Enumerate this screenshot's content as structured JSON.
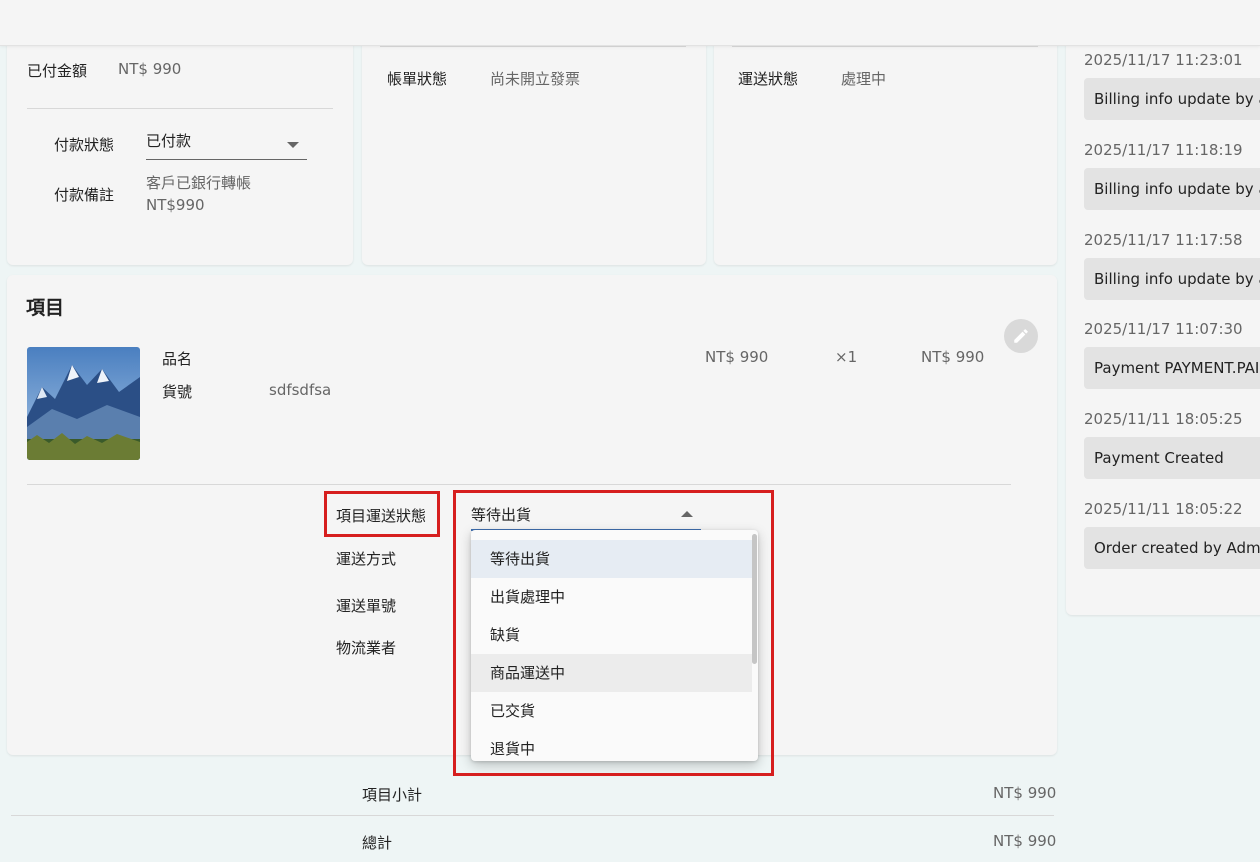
{
  "payment": {
    "paid_amount_label": "已付金額",
    "paid_amount_value": "NT$ 990",
    "status_label": "付款狀態",
    "status_value": "已付款",
    "note_label": "付款備註",
    "note_line1": "客戶已銀行轉帳",
    "note_line2": "NT$990"
  },
  "billing": {
    "status_label": "帳單狀態",
    "status_value": "尚未開立發票"
  },
  "shipping": {
    "status_label": "運送狀態",
    "status_value": "處理中"
  },
  "items": {
    "title": "項目",
    "product": {
      "name_label": "品名",
      "sku_label": "貨號",
      "sku_value": "sdfsdfsa",
      "unit_price": "NT$ 990",
      "quantity": "×1",
      "total": "NT$ 990"
    },
    "fields": {
      "ship_status_label": "項目運送狀態",
      "ship_status_value": "等待出貨",
      "ship_method_label": "運送方式",
      "tracking_label": "運送單號",
      "carrier_label": "物流業者"
    },
    "dropdown_options": [
      "等待出貨",
      "出貨處理中",
      "缺貨",
      "商品運送中",
      "已交貨",
      "退貨中"
    ]
  },
  "summary": {
    "subtotal_label": "項目小計",
    "subtotal_value": "NT$ 990",
    "total_label": "總計",
    "total_value": "NT$ 990"
  },
  "activity": [
    {
      "time": "2025/11/17 11:23:01",
      "message": "Billing info update by admin"
    },
    {
      "time": "2025/11/17 11:18:19",
      "message": "Billing info update by admin"
    },
    {
      "time": "2025/11/17 11:17:58",
      "message": "Billing info update by admin"
    },
    {
      "time": "2025/11/17 11:07:30",
      "message": "Payment PAYMENT.PAID"
    },
    {
      "time": "2025/11/11 18:05:25",
      "message": "Payment Created"
    },
    {
      "time": "2025/11/11 18:05:22",
      "message": "Order created by Admin"
    }
  ],
  "colors": {
    "highlight": "#d61f1f",
    "selected_bg": "#e6ecf3"
  },
  "icons": {
    "edit": "pencil-icon",
    "dropdown": "caret-icon"
  }
}
